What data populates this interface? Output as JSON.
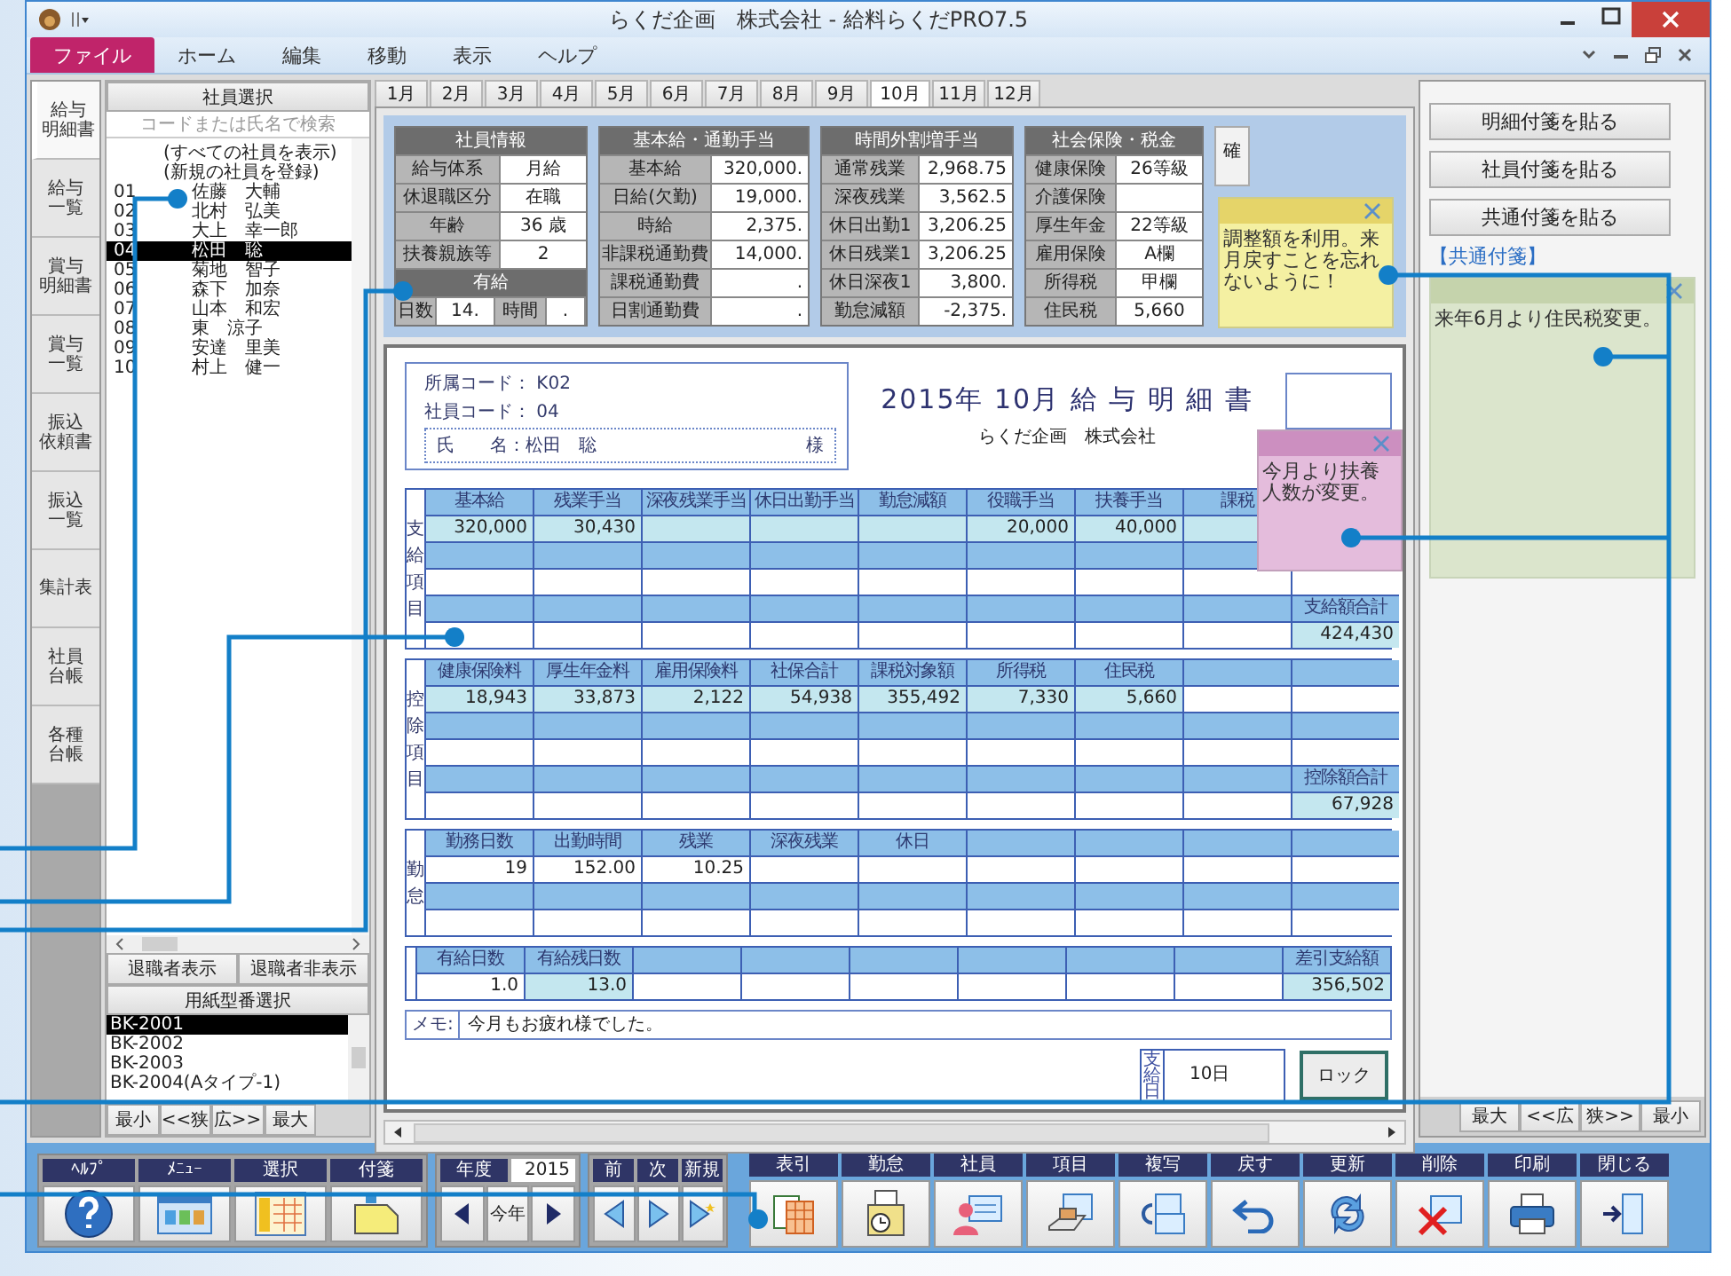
{
  "window": {
    "title": "らくだ企画　株式会社 - 給料らくだPRO7.5"
  },
  "menu": [
    {
      "label": "ファイル",
      "selected": true
    },
    {
      "label": "ホーム",
      "selected": false
    },
    {
      "label": "編集",
      "selected": false
    },
    {
      "label": "移動",
      "selected": false
    },
    {
      "label": "表示",
      "selected": false
    },
    {
      "label": "ヘルプ",
      "selected": false
    }
  ],
  "side_tabs": [
    {
      "lines": [
        "給与",
        "明細書"
      ],
      "selected": true
    },
    {
      "lines": [
        "給与",
        "一覧"
      ],
      "selected": false
    },
    {
      "lines": [
        "賞与",
        "明細書"
      ],
      "selected": false
    },
    {
      "lines": [
        "賞与",
        "一覧"
      ],
      "selected": false
    },
    {
      "lines": [
        "振込",
        "依頼書"
      ],
      "selected": false
    },
    {
      "lines": [
        "振込",
        "一覧"
      ],
      "selected": false
    },
    {
      "lines": [
        "集計表"
      ],
      "selected": false
    },
    {
      "lines": [
        "社員",
        "台帳"
      ],
      "selected": false
    },
    {
      "lines": [
        "各種",
        "台帳"
      ],
      "selected": false
    }
  ],
  "employees": {
    "header": "社員選択",
    "placeholder": "コードまたは氏名で検索",
    "options": [
      "(すべての社員を表示)",
      "(新規の社員を登録)"
    ],
    "rows": [
      {
        "code": "01",
        "name": "佐藤　大輔",
        "selected": false
      },
      {
        "code": "02",
        "name": "北村　弘美",
        "selected": false
      },
      {
        "code": "03",
        "name": "大上　幸一郎",
        "selected": false
      },
      {
        "code": "04",
        "name": "松田　聡",
        "selected": true
      },
      {
        "code": "05",
        "name": "菊地　智子",
        "selected": false
      },
      {
        "code": "06",
        "name": "森下　加奈",
        "selected": false
      },
      {
        "code": "07",
        "name": "山本　和宏",
        "selected": false
      },
      {
        "code": "08",
        "name": "東　涼子",
        "selected": false
      },
      {
        "code": "09",
        "name": "安達　里美",
        "selected": false
      },
      {
        "code": "10",
        "name": "村上　健一",
        "selected": false
      }
    ],
    "buttons": [
      "退職者表示",
      "退職者非表示"
    ]
  },
  "paper": {
    "header": "用紙型番選択",
    "items": [
      {
        "label": "BK-2001",
        "selected": true
      },
      {
        "label": "BK-2002",
        "selected": false
      },
      {
        "label": "BK-2003",
        "selected": false
      },
      {
        "label": "BK-2004(Aタイプ-1)",
        "selected": false
      }
    ],
    "buttons": [
      "最小",
      "<<狭",
      "広>>",
      "最大"
    ]
  },
  "months": [
    {
      "label": "1月",
      "selected": false
    },
    {
      "label": "2月",
      "selected": false
    },
    {
      "label": "3月",
      "selected": false
    },
    {
      "label": "4月",
      "selected": false
    },
    {
      "label": "5月",
      "selected": false
    },
    {
      "label": "6月",
      "selected": false
    },
    {
      "label": "7月",
      "selected": false
    },
    {
      "label": "8月",
      "selected": false
    },
    {
      "label": "9月",
      "selected": false
    },
    {
      "label": "10月",
      "selected": true
    },
    {
      "label": "11月",
      "selected": false
    },
    {
      "label": "12月",
      "selected": false
    }
  ],
  "info_tables": [
    {
      "title": "社員情報",
      "rows": [
        {
          "label": "給与体系",
          "value": "月給"
        },
        {
          "label": "休退職区分",
          "value": "在職"
        },
        {
          "label": "年齢",
          "value": "36 歳"
        },
        {
          "label": "扶養親族等",
          "value": "2"
        }
      ],
      "paid_leave": {
        "title": "有給",
        "days_label": "日数",
        "days": "14.",
        "hours_label": "時間",
        "hours": "."
      }
    },
    {
      "title": "基本給・通勤手当",
      "rows": [
        {
          "label": "基本給",
          "value": "320,000."
        },
        {
          "label": "日給(欠勤)",
          "value": "19,000."
        },
        {
          "label": "時給",
          "value": "2,375."
        },
        {
          "label": "非課税通勤費",
          "value": "14,000."
        },
        {
          "label": "課税通勤費",
          "value": "."
        },
        {
          "label": "日割通勤費",
          "value": "."
        }
      ]
    },
    {
      "title": "時間外割増手当",
      "rows": [
        {
          "label": "通常残業",
          "value": "2,968.75"
        },
        {
          "label": "深夜残業",
          "value": "3,562.5"
        },
        {
          "label": "休日出勤1",
          "value": "3,206.25"
        },
        {
          "label": "休日残業1",
          "value": "3,206.25"
        },
        {
          "label": "休日深夜1",
          "value": "3,800."
        },
        {
          "label": "勤怠減額",
          "value": "-2,375."
        }
      ]
    },
    {
      "title": "社会保険・税金",
      "rows": [
        {
          "label": "健康保険",
          "value": "26等級"
        },
        {
          "label": "介護保険"
        },
        {
          "label": "厚生年金",
          "value": "22等級"
        },
        {
          "label": "雇用保険",
          "value": "A欄"
        },
        {
          "label": "所得税",
          "value": "甲欄"
        },
        {
          "label": "住民税",
          "value": "5,660"
        }
      ]
    }
  ],
  "confirm_button": "確",
  "payslip": {
    "department": {
      "label": "所属コード：",
      "value": "K02"
    },
    "employee_code": {
      "label": "社員コード：",
      "value": "04"
    },
    "name": {
      "label": "氏　　名：",
      "value": "松田　聡",
      "honorific": "様"
    },
    "title": "2015年 10月 給 与 明 細 書",
    "company": "らくだ企画　株式会社",
    "sections": [
      {
        "label": "支給項目",
        "rows": [
          {
            "kind": "header",
            "cells": [
              "基本給",
              "残業手当",
              "深夜残業手当",
              "休日出勤手当",
              "勤怠減額",
              "役職手当",
              "扶養手当",
              "課税"
            ]
          },
          {
            "kind": "values",
            "cells": [
              {
                "text": "320,000",
                "shaded": true
              },
              {
                "text": "30,430",
                "shaded": true
              },
              {
                "shaded": true
              },
              {
                "shaded": true
              },
              {
                "shaded": true
              },
              {
                "text": "20,000",
                "shaded": true
              },
              {
                "text": "40,000",
                "shaded": true
              },
              {
                "shaded": true
              }
            ]
          },
          {
            "kind": "band"
          },
          {
            "kind": "blank"
          },
          {
            "kind": "band",
            "total": "支給額合計"
          },
          {
            "kind": "blank",
            "total": "424,430"
          }
        ]
      },
      {
        "label": "控除項目",
        "rows": [
          {
            "kind": "header",
            "cells": [
              "健康保険料",
              "厚生年金料",
              "雇用保険料",
              "社保合計",
              "課税対象額",
              "所得税",
              "住民税"
            ]
          },
          {
            "kind": "values",
            "cells": [
              {
                "text": "18,943",
                "shaded": true
              },
              {
                "text": "33,873",
                "shaded": true
              },
              {
                "text": "2,122",
                "shaded": true
              },
              {
                "text": "54,938",
                "shaded": true
              },
              {
                "text": "355,492",
                "shaded": true
              },
              {
                "text": "7,330",
                "shaded": true
              },
              {
                "text": "5,660",
                "shaded": true
              }
            ]
          },
          {
            "kind": "band"
          },
          {
            "kind": "blank"
          },
          {
            "kind": "band",
            "total": "控除額合計"
          },
          {
            "kind": "blank",
            "total": "67,928"
          }
        ]
      },
      {
        "label": "勤怠",
        "rows": [
          {
            "kind": "header",
            "cells": [
              "勤務日数",
              "出勤時間",
              "残業",
              "深夜残業",
              "休日"
            ]
          },
          {
            "kind": "values",
            "cells": [
              {
                "text": "19",
                "shaded": false
              },
              {
                "text": "152.00",
                "shaded": false
              },
              {
                "text": "10.25",
                "shaded": false
              }
            ]
          },
          {
            "kind": "band"
          },
          {
            "kind": "blank"
          }
        ]
      },
      {
        "rows": [
          {
            "kind": "header",
            "cells": [
              "有給日数",
              "有給残日数"
            ],
            "total": "差引支給額"
          },
          {
            "kind": "values",
            "cells": [
              {
                "text": "1.0",
                "shaded": false
              },
              {
                "text": "13.0",
                "shaded": true
              }
            ],
            "total": "356,502"
          }
        ]
      }
    ],
    "memo": {
      "label": "メモ:",
      "value": "今月もお疲れ様でした。"
    },
    "pay_date": {
      "label": "支給日",
      "value": "10日"
    },
    "lock_button": "ロック"
  },
  "sticky_notes": [
    {
      "text": "調整額を利用。来月戻すことを忘れないように！",
      "color": "#f4f0a2"
    },
    {
      "text": "今月より扶養人数が変更。",
      "color": "#e4bcdc"
    }
  ],
  "right_panel": {
    "buttons": [
      "明細付箋を貼る",
      "社員付箋を貼る",
      "共通付箋を貼る"
    ],
    "label": "【共通付箋】",
    "note": "来年6月より住民税変更。",
    "size_buttons": [
      "最大",
      "<<広",
      "狭>>",
      "最小"
    ]
  },
  "toolbar": {
    "tools": [
      "ﾍﾙﾌﾟ",
      "ﾒﾆｭｰ",
      "選択",
      "付箋"
    ],
    "year": {
      "label": "年度",
      "value": "2015",
      "current_button": "今年"
    },
    "nav": [
      "前",
      "次",
      "新規"
    ],
    "actions": [
      "表引",
      "勤怠",
      "社員",
      "項目",
      "複写",
      "戻す",
      "更新",
      "削除",
      "印刷",
      "閉じる"
    ]
  }
}
